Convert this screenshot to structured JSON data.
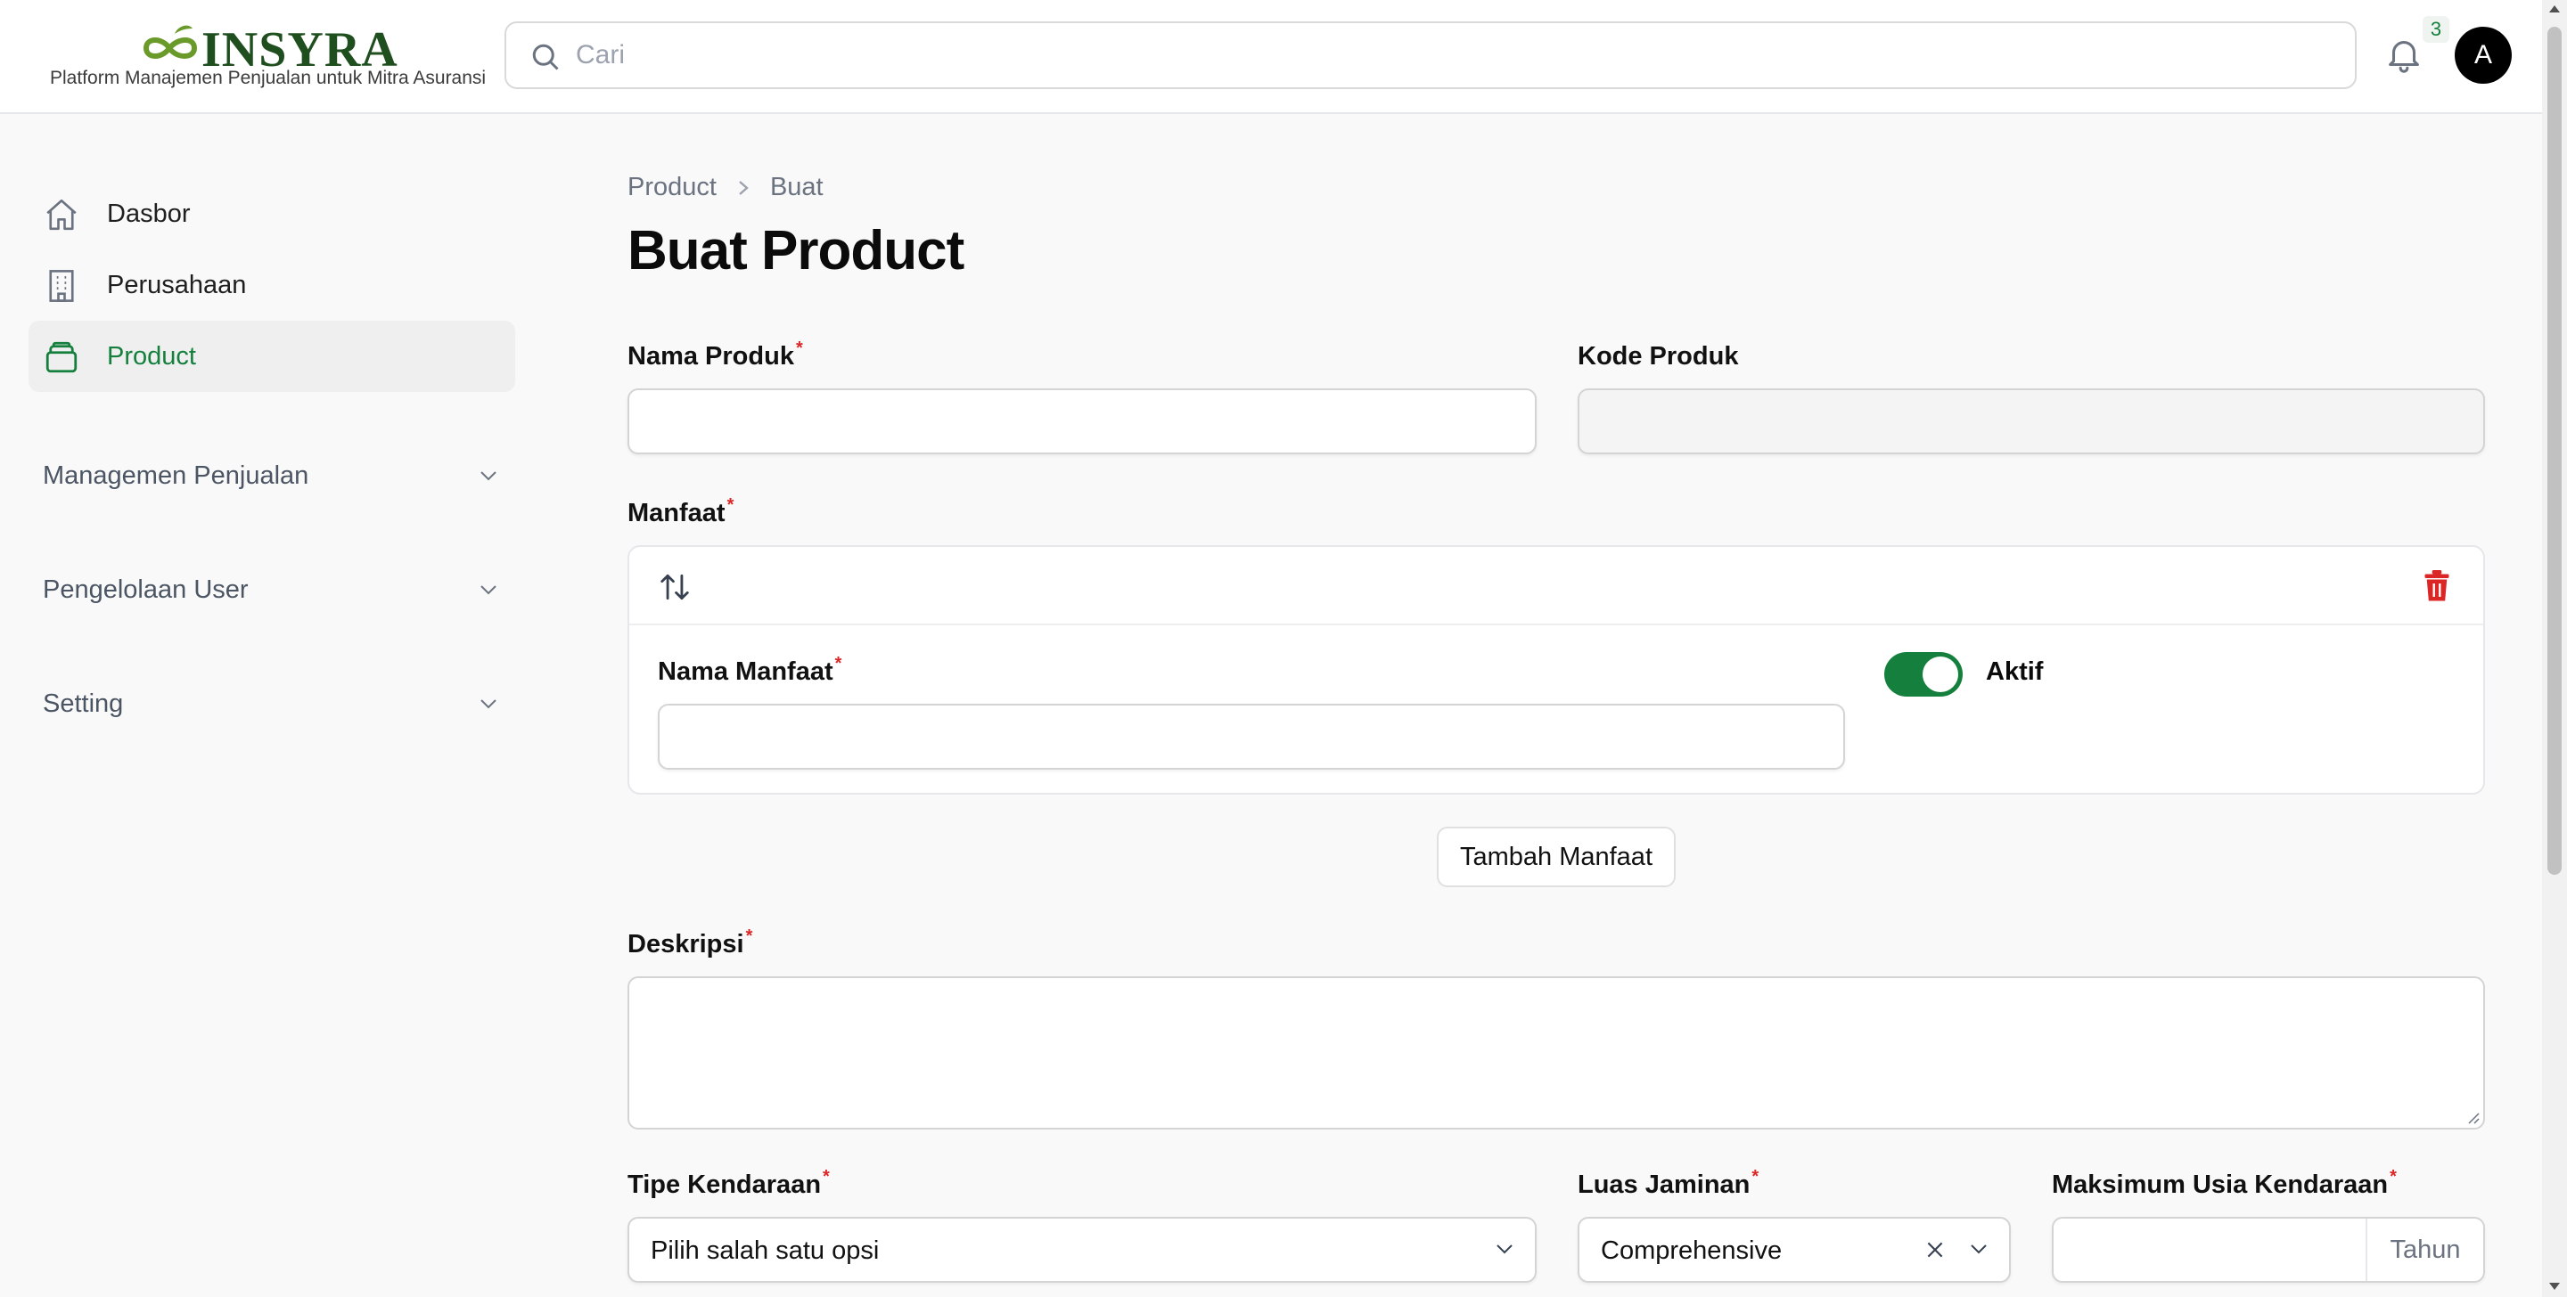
{
  "app": {
    "name": "INSYRA",
    "tagline": "Platform Manajemen Penjualan untuk Mitra Asuransi",
    "brand_color": "#15803d"
  },
  "header": {
    "search_placeholder": "Cari",
    "notification_count": "3",
    "avatar_initial": "A"
  },
  "sidebar": {
    "items": [
      {
        "label": "Dasbor",
        "icon": "home-icon",
        "active": false
      },
      {
        "label": "Perusahaan",
        "icon": "building-icon",
        "active": false
      },
      {
        "label": "Product",
        "icon": "wallet-icon",
        "active": true
      }
    ],
    "groups": [
      {
        "label": "Managemen Penjualan"
      },
      {
        "label": "Pengelolaan User"
      },
      {
        "label": "Setting"
      }
    ]
  },
  "breadcrumb": {
    "items": [
      "Product",
      "Buat"
    ]
  },
  "page": {
    "title": "Buat Product"
  },
  "form": {
    "nama_produk": {
      "label": "Nama Produk",
      "value": ""
    },
    "kode_produk": {
      "label": "Kode Produk",
      "value": ""
    },
    "manfaat": {
      "label": "Manfaat",
      "nama_manfaat_label": "Nama Manfaat",
      "nama_manfaat_value": "",
      "aktif_label": "Aktif",
      "aktif": true,
      "add_button": "Tambah Manfaat"
    },
    "deskripsi": {
      "label": "Deskripsi",
      "value": ""
    },
    "tipe_kendaraan": {
      "label": "Tipe Kendaraan",
      "value": "Pilih salah satu opsi"
    },
    "luas_jaminan": {
      "label": "Luas Jaminan",
      "value": "Comprehensive"
    },
    "maks_usia": {
      "label": "Maksimum Usia Kendaraan",
      "value": "",
      "suffix": "Tahun"
    },
    "required_mark": "*"
  }
}
